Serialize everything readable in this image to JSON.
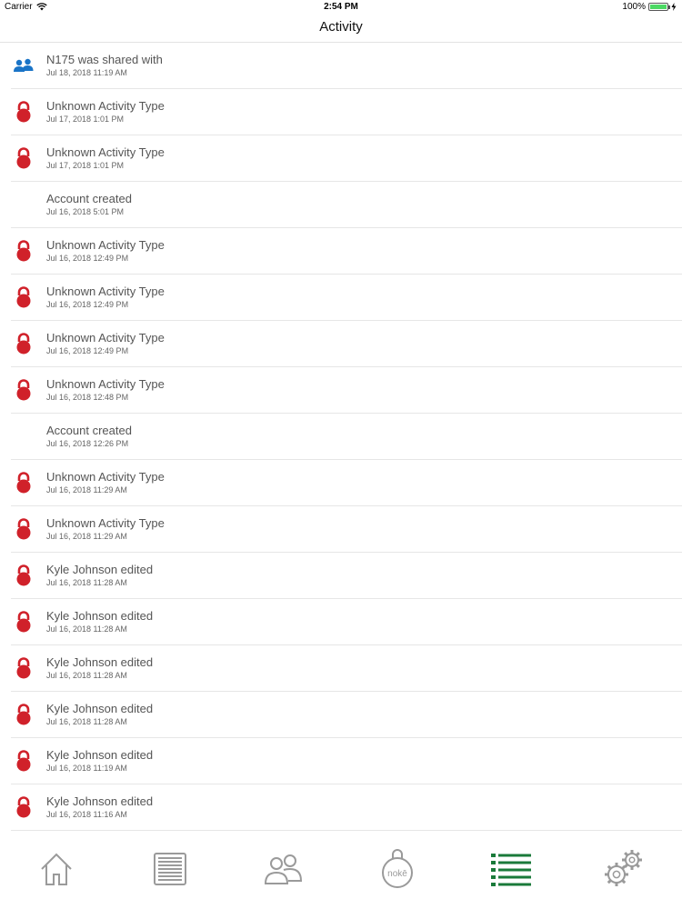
{
  "status_bar": {
    "carrier": "Carrier",
    "time": "2:54 PM",
    "battery": "100%",
    "battery_level": 1.0
  },
  "nav": {
    "title": "Activity"
  },
  "colors": {
    "lock": "#d0212a",
    "people": "#1a74c7",
    "tab_active": "#1a7a3a",
    "tab_inactive": "#9a9a9a"
  },
  "activity": [
    {
      "icon": "people-icon",
      "title": "N175 was shared with",
      "time": "Jul 18, 2018 11:19 AM"
    },
    {
      "icon": "lock-icon",
      "title": "Unknown Activity Type",
      "time": "Jul 17, 2018 1:01 PM"
    },
    {
      "icon": "lock-icon",
      "title": "Unknown Activity Type",
      "time": "Jul 17, 2018 1:01 PM"
    },
    {
      "icon": "none",
      "title": "Account created",
      "time": "Jul 16, 2018 5:01 PM"
    },
    {
      "icon": "lock-icon",
      "title": "Unknown Activity Type",
      "time": "Jul 16, 2018 12:49 PM"
    },
    {
      "icon": "lock-icon",
      "title": "Unknown Activity Type",
      "time": "Jul 16, 2018 12:49 PM"
    },
    {
      "icon": "lock-icon",
      "title": "Unknown Activity Type",
      "time": "Jul 16, 2018 12:49 PM"
    },
    {
      "icon": "lock-icon",
      "title": "Unknown Activity Type",
      "time": "Jul 16, 2018 12:48 PM"
    },
    {
      "icon": "none",
      "title": "Account created",
      "time": "Jul 16, 2018 12:26 PM"
    },
    {
      "icon": "lock-icon",
      "title": "Unknown Activity Type",
      "time": "Jul 16, 2018 11:29 AM"
    },
    {
      "icon": "lock-icon",
      "title": "Unknown Activity Type",
      "time": "Jul 16, 2018 11:29 AM"
    },
    {
      "icon": "lock-icon",
      "title": "Kyle Johnson edited",
      "time": "Jul 16, 2018 11:28 AM"
    },
    {
      "icon": "lock-icon",
      "title": "Kyle Johnson edited",
      "time": "Jul 16, 2018 11:28 AM"
    },
    {
      "icon": "lock-icon",
      "title": "Kyle Johnson edited",
      "time": "Jul 16, 2018 11:28 AM"
    },
    {
      "icon": "lock-icon",
      "title": "Kyle Johnson edited",
      "time": "Jul 16, 2018 11:28 AM"
    },
    {
      "icon": "lock-icon",
      "title": "Kyle Johnson edited",
      "time": "Jul 16, 2018 11:19 AM"
    },
    {
      "icon": "lock-icon",
      "title": "Kyle Johnson edited",
      "time": "Jul 16, 2018 11:16 AM"
    }
  ],
  "tabs": [
    {
      "name": "home-icon",
      "active": false
    },
    {
      "name": "storage-unit-icon",
      "active": false
    },
    {
      "name": "users-icon",
      "active": false
    },
    {
      "name": "noke-lock-icon",
      "active": false,
      "label": "nokē"
    },
    {
      "name": "activity-list-icon",
      "active": true
    },
    {
      "name": "settings-gears-icon",
      "active": false
    }
  ]
}
